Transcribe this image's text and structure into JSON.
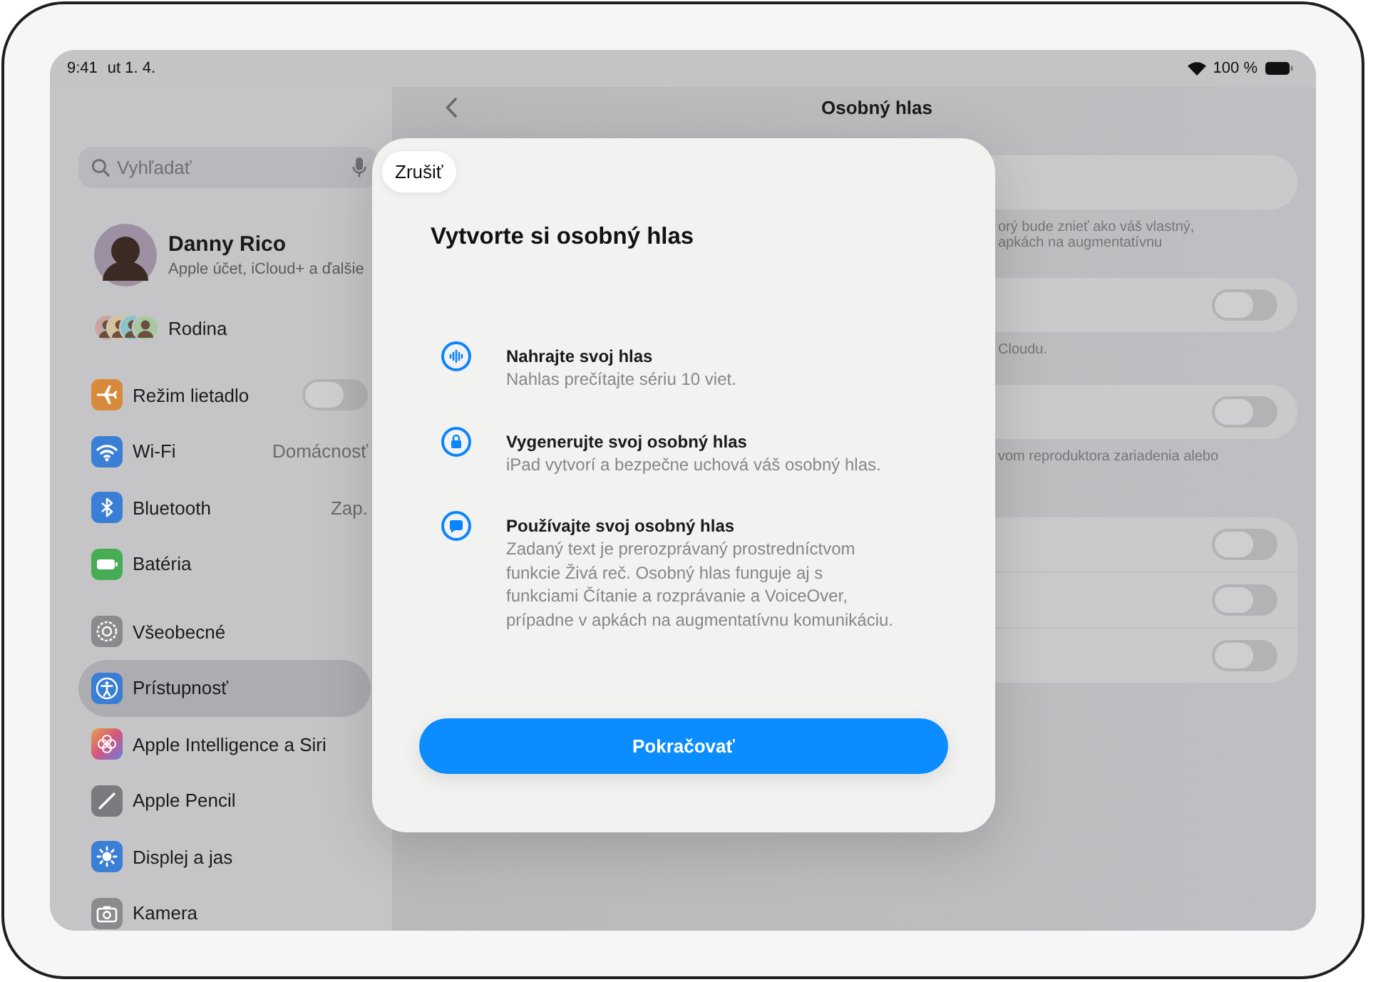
{
  "status_bar": {
    "time": "9:41",
    "date": "ut 1. 4.",
    "battery": "100 %"
  },
  "sidebar": {
    "search": {
      "placeholder": "Vyhľadať"
    },
    "profile": {
      "name": "Danny Rico",
      "subtitle": "Apple účet, iCloud+ a ďalšie"
    },
    "family": {
      "label": "Rodina"
    },
    "groups": [
      {
        "items": [
          {
            "label": "Režim lietadlo",
            "kind": "toggle",
            "on": false,
            "selected": false
          },
          {
            "label": "Wi-Fi",
            "kind": "value",
            "value": "Domácnosť",
            "selected": false
          },
          {
            "label": "Bluetooth",
            "kind": "value",
            "value": "Zap.",
            "selected": false
          },
          {
            "label": "Batéria",
            "kind": "plain",
            "selected": false
          }
        ]
      },
      {
        "items": [
          {
            "label": "Všeobecné",
            "kind": "plain",
            "selected": false
          },
          {
            "label": "Prístupnosť",
            "kind": "plain",
            "selected": true
          },
          {
            "label": "Apple Intelligence a Siri",
            "kind": "plain",
            "selected": false
          },
          {
            "label": "Apple Pencil",
            "kind": "plain",
            "selected": false
          },
          {
            "label": "Displej a jas",
            "kind": "plain",
            "selected": false
          },
          {
            "label": "Kamera",
            "kind": "plain",
            "selected": false
          }
        ]
      }
    ]
  },
  "detail": {
    "title": "Osobný hlas",
    "sections": [
      {
        "rows": [
          {
            "kind": "field"
          }
        ],
        "footer": [
          "orý bude znieť ako váš vlastný,",
          "apkách na augmentatívnu"
        ]
      },
      {
        "rows": [
          {
            "kind": "toggle",
            "on": false
          }
        ],
        "footer": [
          "Cloudu."
        ]
      },
      {
        "rows": [
          {
            "kind": "toggle",
            "on": false
          }
        ],
        "footer": [
          "vom reproduktora zariadenia alebo"
        ]
      },
      {
        "rows": [
          {
            "kind": "toggle",
            "on": false
          },
          {
            "kind": "toggle",
            "on": false
          },
          {
            "kind": "toggle",
            "on": false
          }
        ]
      }
    ]
  },
  "dialog": {
    "cancel": "Zrušiť",
    "title": "Vytvorte si osobný hlas",
    "features": [
      {
        "title": "Nahrajte svoj hlas",
        "text": "Nahlas prečítajte sériu 10 viet."
      },
      {
        "title": "Vygenerujte svoj osobný hlas",
        "text": "iPad vytvorí a bezpečne uchová váš osobný hlas."
      },
      {
        "title": "Používajte svoj osobný hlas",
        "text": "Zadaný text je prerozprávaný prostredníctvom funkcie Živá reč. Osobný hlas funguje aj s funkciami Čítanie a rozprávanie a VoiceOver, prípadne v apkách na augmentatívnu komunikáciu."
      }
    ],
    "continue": "Pokračovať"
  }
}
